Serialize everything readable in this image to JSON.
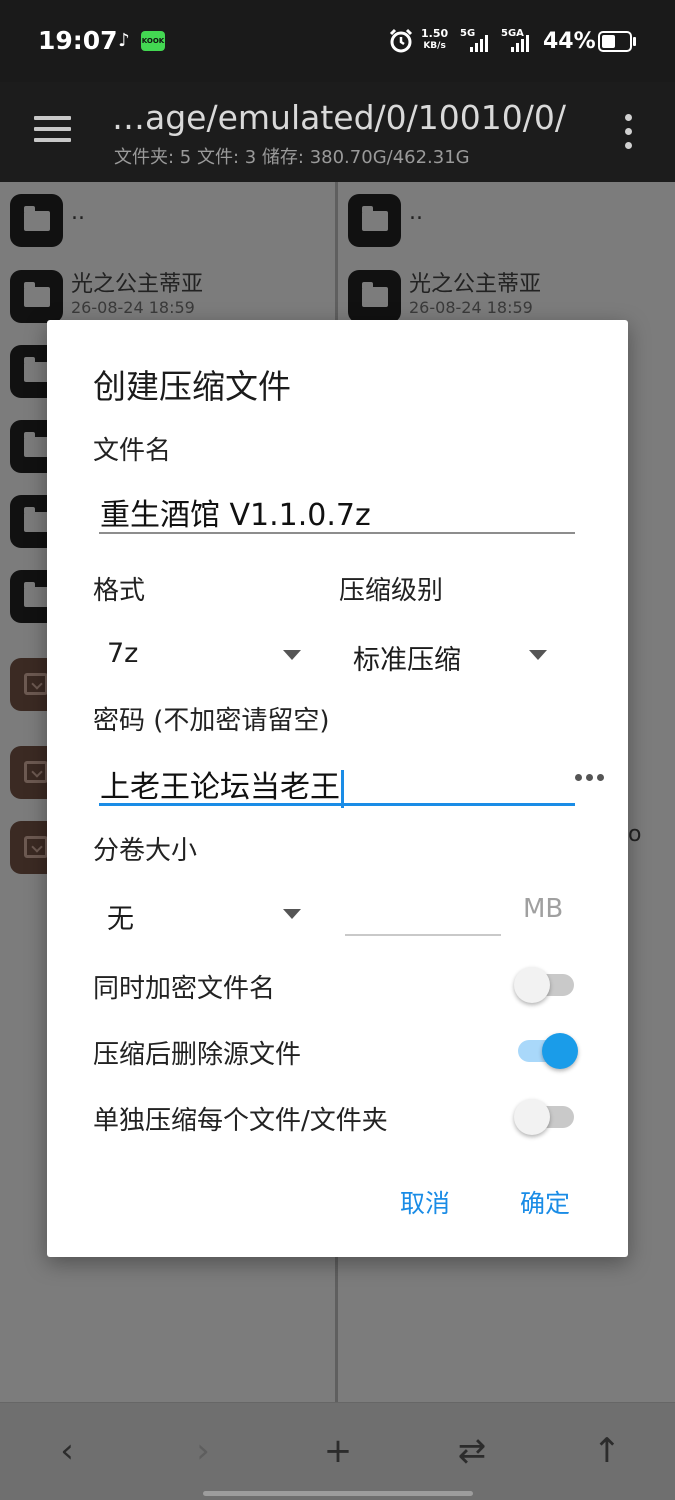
{
  "status_bar": {
    "time": "19:07",
    "net_speed_value": "1.50",
    "net_speed_unit": "KB/s",
    "signal1_label": "5G",
    "signal2_label": "5GA",
    "battery_percent": "44%",
    "battery_level": 0.44,
    "app_icons": [
      "tiktok-icon",
      "kook-icon"
    ],
    "kook_label": "KOOK"
  },
  "app_bar": {
    "path": "…age/emulated/0/10010/0/",
    "summary": "文件夹: 5  文件: 3  储存: 380.70G/462.31G"
  },
  "left_pane": {
    "items": [
      {
        "name": "..",
        "date": "",
        "icon": "folder-icon"
      },
      {
        "name": "光之公主蒂亚",
        "date": "26-08-24 18:59",
        "icon": "folder-icon"
      }
    ]
  },
  "right_pane": {
    "items": [
      {
        "name": "..",
        "date": "",
        "icon": "folder-icon"
      },
      {
        "name": "光之公主蒂亚",
        "date": "26-08-24 18:59",
        "icon": "folder-icon"
      }
    ],
    "partial_glyph": "o"
  },
  "dialog": {
    "title": "创建压缩文件",
    "filename_label": "文件名",
    "filename_value": "重生酒馆 V1.1.0.7z",
    "format_label": "格式",
    "format_value": "7z",
    "level_label": "压缩级别",
    "level_value": "标准压缩",
    "password_label": "密码 (不加密请留空)",
    "password_value": "上老王论坛当老王",
    "split_label": "分卷大小",
    "split_value": "无",
    "split_size_value": "",
    "split_unit": "MB",
    "options": [
      {
        "label": "同时加密文件名",
        "checked": false
      },
      {
        "label": "压缩后删除源文件",
        "checked": true
      },
      {
        "label": "单独压缩每个文件/文件夹",
        "checked": false
      }
    ],
    "cancel_label": "取消",
    "ok_label": "确定",
    "accent_color": "#1a8ce6"
  },
  "bottom_bar": {
    "back": "‹",
    "forward": "›",
    "add": "+",
    "swap": "⇄",
    "up": "↑"
  }
}
